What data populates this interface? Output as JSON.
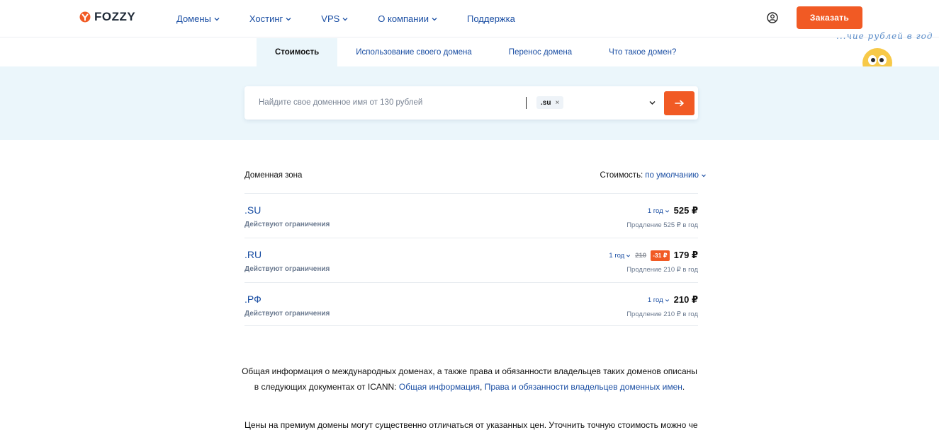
{
  "header": {
    "logo_text": "FOZZY",
    "nav": [
      {
        "label": "Домены",
        "has_dropdown": true
      },
      {
        "label": "Хостинг",
        "has_dropdown": true
      },
      {
        "label": "VPS",
        "has_dropdown": true
      },
      {
        "label": "О компании",
        "has_dropdown": true
      },
      {
        "label": "Поддержка",
        "has_dropdown": false
      }
    ],
    "order_button": "Заказать",
    "icons": {
      "logo": "fozzy-logo-icon",
      "user": "user-account-icon"
    }
  },
  "tabs": [
    {
      "label": "Стоимость",
      "active": true
    },
    {
      "label": "Использование своего домена",
      "active": false
    },
    {
      "label": "Перенос домена",
      "active": false
    },
    {
      "label": "Что такое домен?",
      "active": false
    }
  ],
  "handnote": "...чие рублей в год",
  "search": {
    "placeholder": "Найдите свое доменное имя от 130 рублей",
    "chip": ".su",
    "submit_icon": "arrow-right-icon"
  },
  "list": {
    "zone_header": "Доменная зона",
    "sort_label": "Стоимость:",
    "sort_value": "по умолчанию",
    "rows": [
      {
        "zone": ".SU",
        "restriction": "Действуют ограничения",
        "period": "1 год",
        "old_price": "",
        "discount": "",
        "price": "525 ₽",
        "renew": "Продление 525 ₽ в год"
      },
      {
        "zone": ".RU",
        "restriction": "Действуют ограничения",
        "period": "1 год",
        "old_price": "210",
        "discount": "-31 ₽",
        "price": "179 ₽",
        "renew": "Продление 210 ₽ в год"
      },
      {
        "zone": ".РФ",
        "restriction": "Действуют ограничения",
        "period": "1 год",
        "old_price": "",
        "discount": "",
        "price": "210 ₽",
        "renew": "Продление 210 ₽ в год"
      }
    ]
  },
  "info": {
    "text_before": "Общая информация о международных доменах, а также права и обязанности владельцев таких доменов описаны в следующих документах от ICANN: ",
    "link1": "Общая информация",
    "sep": ", ",
    "link2": "Права и обязанности владельцев доменных имен",
    "end": ".",
    "text2": "Цены на премиум домены могут существенно отличаться от указанных цен. Уточнить точную стоимость можно через"
  },
  "colors": {
    "accent": "#f15a24",
    "link": "#1a4ea3",
    "band": "#ebf6fb"
  }
}
